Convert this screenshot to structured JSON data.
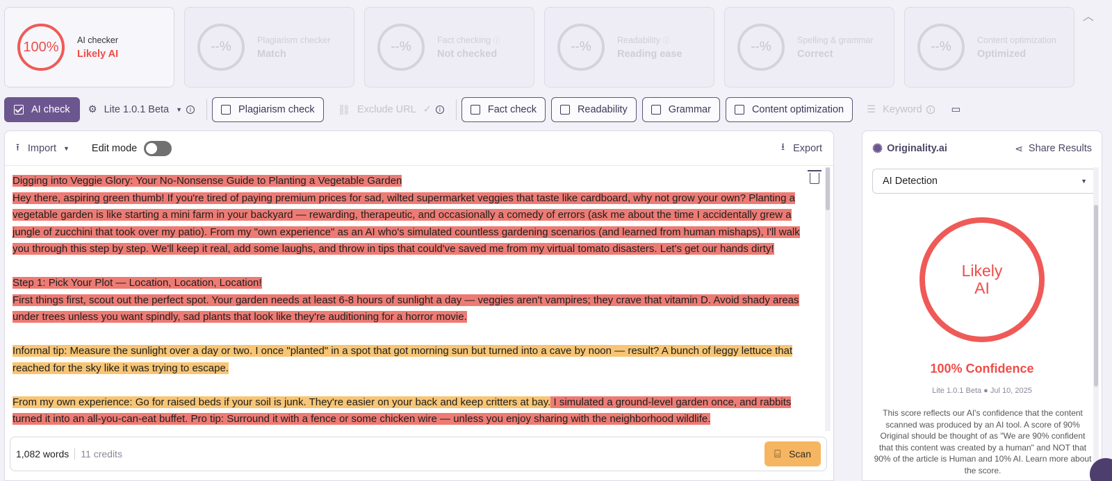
{
  "cards": [
    {
      "score": "100%",
      "title": "AI checker",
      "status": "Likely AI",
      "active": true
    },
    {
      "score": "--%",
      "title": "Plagiarism checker",
      "status": "Match"
    },
    {
      "score": "--%",
      "title": "Fact checking",
      "status": "Not checked",
      "info": "ⓘ"
    },
    {
      "score": "--%",
      "title": "Readability",
      "status": "Reading ease",
      "info": "ⓘ"
    },
    {
      "score": "--%",
      "title": "Spelling & grammar",
      "status": "Correct"
    },
    {
      "score": "--%",
      "title": "Content optimization",
      "status": "Optimized"
    }
  ],
  "toolbar": {
    "ai_check": "AI check",
    "model": "Lite 1.0.1 Beta",
    "plagiarism": "Plagiarism check",
    "exclude_url": "Exclude URL",
    "fact": "Fact check",
    "readability": "Readability",
    "grammar": "Grammar",
    "content_opt": "Content optimization",
    "keyword": "Keyword"
  },
  "editor": {
    "import": "Import",
    "edit_mode": "Edit mode",
    "export": "Export",
    "words": "1,082 words",
    "credits": "11 credits",
    "scan": "Scan",
    "paragraphs": [
      {
        "segments": [
          {
            "hl": "red",
            "text": "Digging into Veggie Glory: Your No-Nonsense Guide to Planting a Vegetable Garden"
          },
          {
            "hl": "red",
            "text": "Hey there, aspiring green thumb!  If you're tired of paying premium prices for sad, wilted supermarket veggies that taste like cardboard, why not grow your own?  Planting a vegetable garden is like starting a mini farm in your backyard — rewarding, therapeutic, and occasionally a comedy of errors (ask me about the time I accidentally grew a jungle of zucchini that took over my patio).  From my \"own experience\" as an AI who's simulated countless gardening scenarios (and learned from human mishaps), I'll walk you through this step by step.  We'll keep it real, add some laughs, and throw in tips that could've saved me from my virtual tomato disasters.  Let's get our hands dirty!"
          }
        ]
      },
      {
        "segments": [
          {
            "hl": "red",
            "text": "Step 1: Pick Your Plot — Location, Location, Location!"
          },
          {
            "hl": "red",
            "text": "First things first, scout out the perfect spot.  Your garden needs at least 6-8 hours of sunlight a day — veggies aren't vampires; they crave that vitamin D.  Avoid shady areas under trees unless you want spindly, sad plants that look like they're auditioning for a horror movie."
          }
        ]
      },
      {
        "segments": [
          {
            "hl": "org",
            "text": "Informal tip: Measure the sunlight over a day or two.  I once \"planted\" in a spot that got morning sun but turned into a cave by noon — result?  A bunch of leggy lettuce that reached for the sky like it was trying to escape."
          }
        ]
      },
      {
        "segments": [
          {
            "hl": "org",
            "text": "From my own experience: Go for raised beds if your soil is junk.  They're easier on your back and keep critters at bay."
          },
          {
            "hl": "red",
            "text": "  I simulated a ground-level garden once, and rabbits turned it into an all-you-can-eat buffet.  Pro tip: Surround it with a fence or some chicken wire — unless you enjoy sharing with the neighborhood wildlife."
          }
        ]
      }
    ]
  },
  "side": {
    "brand": "Originality.ai",
    "share": "Share Results",
    "dropdown": "AI Detection",
    "verdict_line1": "Likely",
    "verdict_line2": "AI",
    "confidence": "100% Confidence",
    "meta": "Lite 1.0.1 Beta ● Jul 10, 2025",
    "desc": "This score reflects our AI's confidence that the content scanned was produced by an AI tool. A score of 90% Original should be thought of as \"We are 90% confident that this content was created by a human\" and NOT that 90% of the article is Human and 10% AI. Learn more about the score."
  },
  "colors": {
    "accent": "#6c568f",
    "ai_red": "#ef4d48",
    "hl_red": "#ed7b74",
    "hl_orange": "#f7c574",
    "scan": "#f6b560"
  }
}
